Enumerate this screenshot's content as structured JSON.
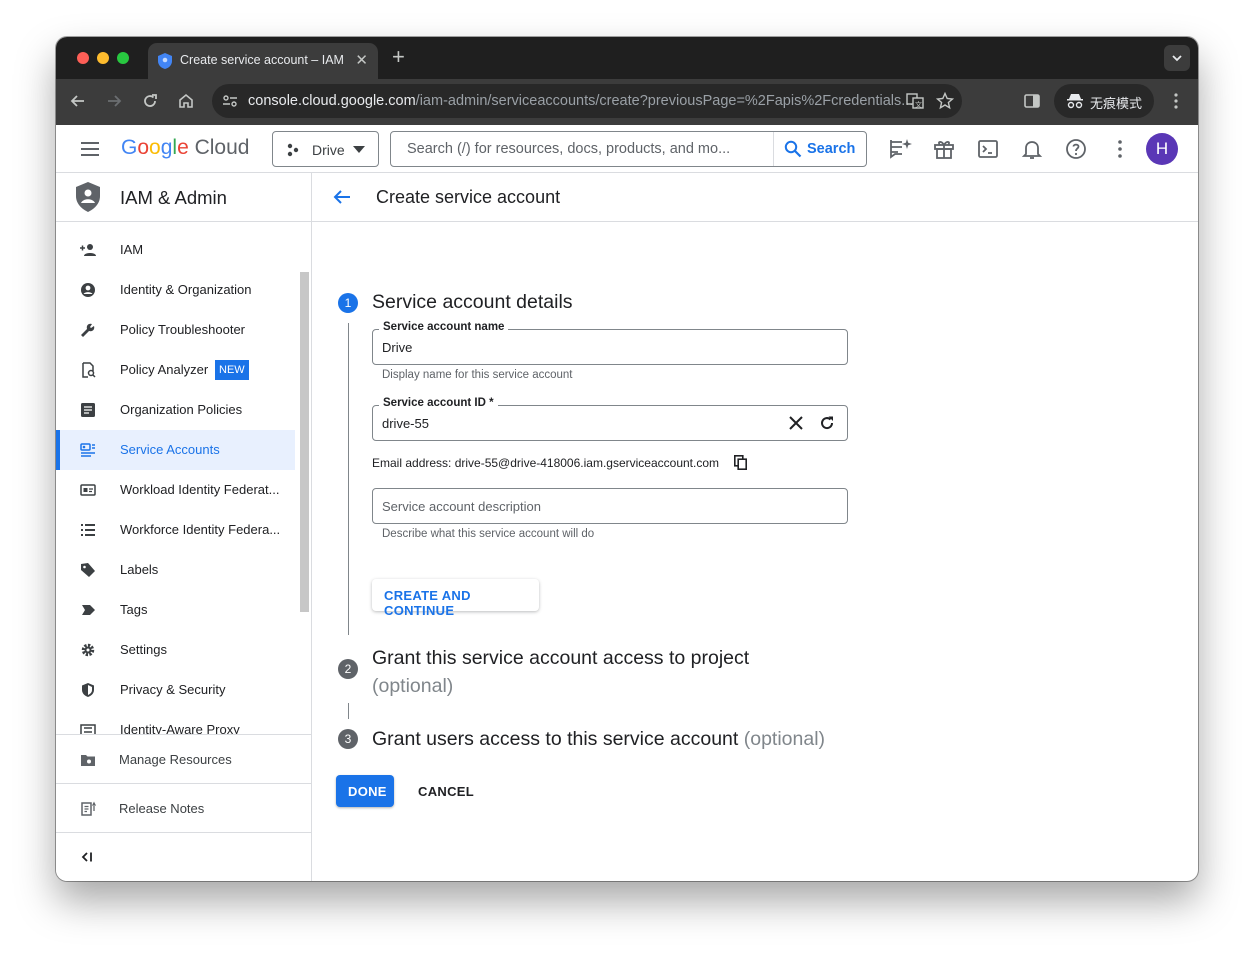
{
  "browser": {
    "tab_title": "Create service account – IAM",
    "url_host": "console.cloud.google.com",
    "url_path": "/iam-admin/serviceaccounts/create?previousPage=%2Fapis%2Fcredentials...",
    "incognito_label": "无痕模式"
  },
  "header": {
    "logo_google": "Google",
    "logo_cloud": "Cloud",
    "project": "Drive",
    "search_placeholder": "Search (/) for resources, docs, products, and mo...",
    "search_button": "Search",
    "avatar_initial": "H"
  },
  "sidebar": {
    "title": "IAM & Admin",
    "items": [
      {
        "label": "IAM",
        "icon": "person-add-icon"
      },
      {
        "label": "Identity & Organization",
        "icon": "account-circle-icon"
      },
      {
        "label": "Policy Troubleshooter",
        "icon": "wrench-icon"
      },
      {
        "label": "Policy Analyzer",
        "icon": "policy-analyzer-icon",
        "badge": "NEW"
      },
      {
        "label": "Organization Policies",
        "icon": "document-list-icon"
      },
      {
        "label": "Service Accounts",
        "icon": "service-account-icon",
        "active": true
      },
      {
        "label": "Workload Identity Federat...",
        "icon": "id-card-icon"
      },
      {
        "label": "Workforce Identity Federa...",
        "icon": "list-icon"
      },
      {
        "label": "Labels",
        "icon": "label-tag-icon"
      },
      {
        "label": "Tags",
        "icon": "tag-arrow-icon"
      },
      {
        "label": "Settings",
        "icon": "gear-icon"
      },
      {
        "label": "Privacy & Security",
        "icon": "shield-icon"
      },
      {
        "label": "Identity-Aware Proxy",
        "icon": "proxy-icon"
      }
    ],
    "manage_resources": "Manage Resources",
    "release_notes": "Release Notes",
    "collapse_icon": "collapse-sidebar-icon"
  },
  "main": {
    "page_title": "Create service account",
    "step1": {
      "number": "1",
      "title": "Service account details",
      "name_label": "Service account name",
      "name_value": "Drive",
      "name_hint": "Display name for this service account",
      "id_label": "Service account ID *",
      "id_value": "drive-55",
      "email_text": "Email address: drive-55@drive-418006.iam.gserviceaccount.com",
      "description_placeholder": "Service account description",
      "description_hint": "Describe what this service account will do",
      "create_button": "CREATE AND CONTINUE"
    },
    "step2": {
      "number": "2",
      "title": "Grant this service account access to project",
      "optional": "(optional)"
    },
    "step3": {
      "number": "3",
      "title": "Grant users access to this service account",
      "optional": "(optional)"
    },
    "done_button": "DONE",
    "cancel_button": "CANCEL"
  },
  "colors": {
    "accent": "#1a73e8",
    "step_active": "#1a73e8",
    "step_inactive": "#5f6368",
    "avatar": "#5a37b6"
  }
}
